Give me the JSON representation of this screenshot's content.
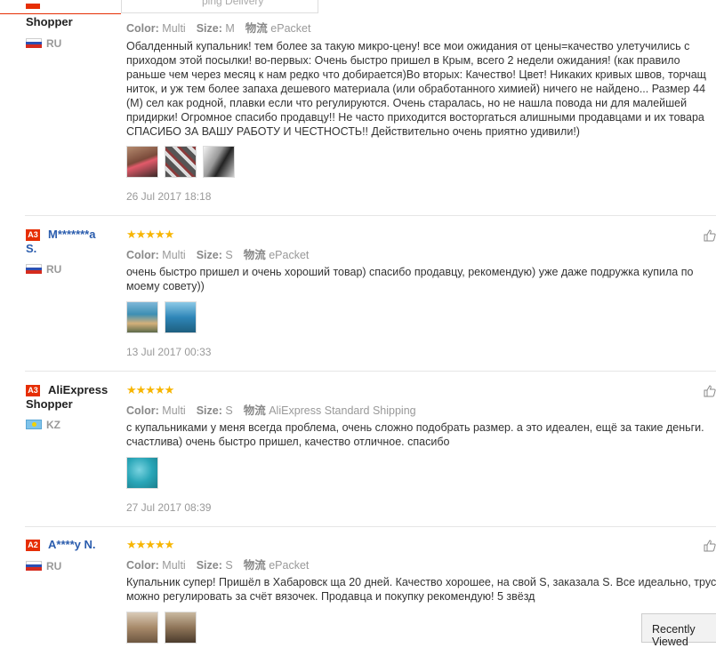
{
  "top_tab": {
    "text": "ping Delivery"
  },
  "labels": {
    "color": "Color:",
    "size": "Size:",
    "shipping_label": "物流"
  },
  "reviews": [
    {
      "badge": "",
      "name_line1": "Shopper",
      "name_line2": "",
      "country": "RU",
      "stars": "★★★★★",
      "color": "Multi",
      "size": "M",
      "shipping": "ePacket",
      "lines": [
        "Обалденный купальник! тем более за такую микро-цену! все мои ожидания от цены=качество улетучились с",
        "приходом этой посылки! во-первых: Очень быстро пришел в Крым, всего 2 недели ожидания! (как правило",
        "раньше чем через месяц к нам редко что добирается)Во вторых: Качество! Цвет! Никаких кривых швов, торчащ",
        "ниток, и уж тем более запаха дешевого материала (или обработанного химией) ничего не найдено... Размер 44",
        "(M) сел как родной, плавки если что регулируются. Очень старалась, но не нашла повода ни для малейшей",
        "придирки! Огромное спасибо продавцу!! Не часто приходится восторгаться алишными продавцами и их товара",
        "СПАСИБО ЗА ВАШУ РАБОТУ И ЧЕСТНОСТЬ!! Действительно очень приятно удивили!)"
      ],
      "date": "26 Jul 2017 18:18"
    },
    {
      "badge": "A3",
      "name_line1": "M*******a",
      "name_line2": "S.",
      "country": "RU",
      "stars": "★★★★★",
      "color": "Multi",
      "size": "S",
      "shipping": "ePacket",
      "lines": [
        "очень быстро пришел и очень хороший товар) спасибо продавцу, рекомендую) уже даже подружка купила по",
        "моему совету))"
      ],
      "date": "13 Jul 2017 00:33"
    },
    {
      "badge": "A3",
      "name_line1": "AliExpress",
      "name_line2": "Shopper",
      "country": "KZ",
      "stars": "★★★★★",
      "color": "Multi",
      "size": "S",
      "shipping": "AliExpress Standard Shipping",
      "lines": [
        "с купальниками у меня всегда проблема, очень сложно подобрать размер. а это идеален, ещё за такие деньги.",
        "счастлива) очень быстро пришел, качество отличное. спасибо"
      ],
      "date": "27 Jul 2017 08:39"
    },
    {
      "badge": "A2",
      "name_line1": "A****y N.",
      "name_line2": "",
      "country": "RU",
      "stars": "★★★★★",
      "color": "Multi",
      "size": "S",
      "shipping": "ePacket",
      "lines": [
        "Купальник супер! Пришёл в Хабаровск ща 20 дней. Качество хорошее, на свой S, заказала S. Все идеально, трус",
        "можно регулировать за счёт вязочек. Продавца и покупку рекомендую! 5 звёзд"
      ],
      "date": ""
    }
  ],
  "recently_viewed": "Recently Viewed",
  "colors": {
    "accent": "#e62e04",
    "star": "#f7b500",
    "muted": "#999999"
  }
}
